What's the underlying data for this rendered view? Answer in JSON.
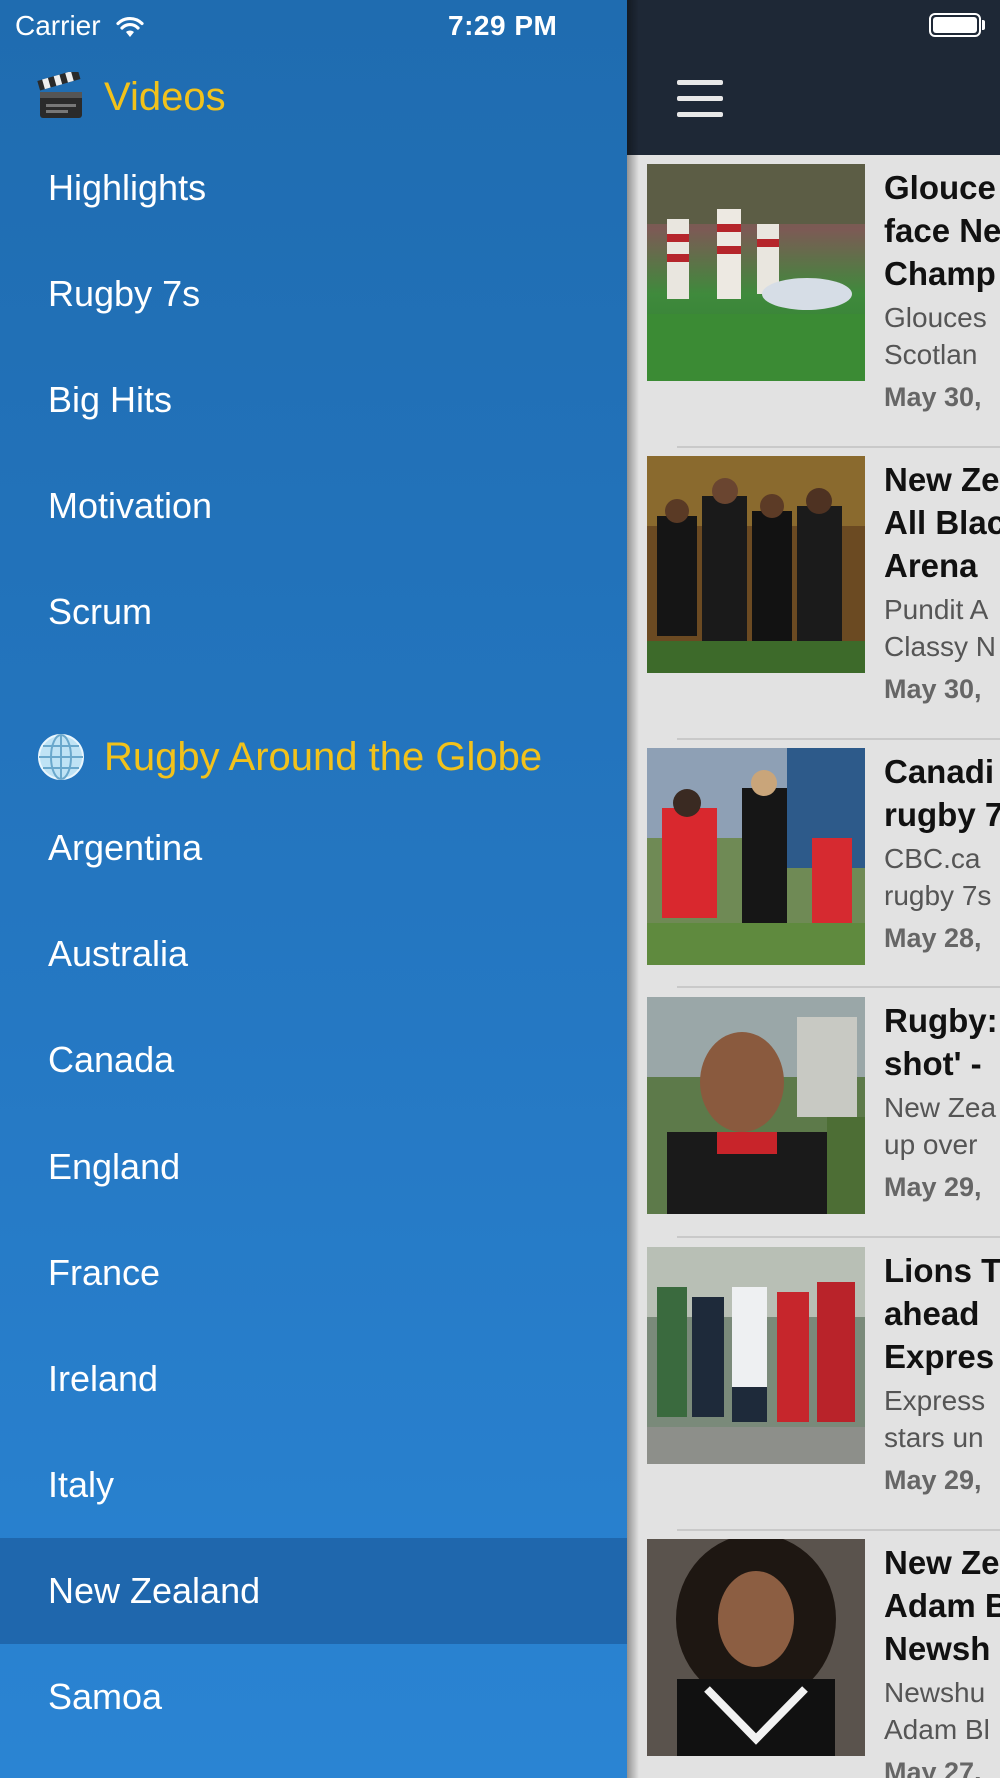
{
  "status_bar": {
    "carrier": "Carrier",
    "time": "7:29 PM"
  },
  "drawer": {
    "sections": [
      {
        "title": "Videos",
        "icon": "clapperboard-icon",
        "items": [
          "Highlights",
          "Rugby 7s",
          "Big Hits",
          "Motivation",
          "Scrum"
        ]
      },
      {
        "title": "Rugby Around the Globe",
        "icon": "globe-icon",
        "items": [
          "Argentina",
          "Australia",
          "Canada",
          "England",
          "France",
          "Ireland",
          "Italy",
          "New Zealand",
          "Samoa"
        ]
      }
    ],
    "selected_item": "New Zealand"
  },
  "colors": {
    "drawer_background": "#2476c0",
    "section_title": "#f2c21b",
    "selected_row": "#1f67ad",
    "navbar": "#1e2836",
    "panel_background": "#e2e2e2"
  },
  "news": {
    "menu_icon": "hamburger-menu-icon",
    "articles": [
      {
        "title_lines": [
          "Glouce",
          "face Ne",
          "Champ"
        ],
        "desc_lines": [
          "Glouces",
          "Scotlan"
        ],
        "date": "May 30,"
      },
      {
        "title_lines": [
          "New Ze",
          "All Blac",
          "Arena"
        ],
        "desc_lines": [
          "Pundit A",
          "Classy N"
        ],
        "date": "May 30,"
      },
      {
        "title_lines": [
          "Canadi",
          "rugby 7"
        ],
        "desc_lines": [
          "CBC.ca",
          "rugby 7s"
        ],
        "date": "May 28,"
      },
      {
        "title_lines": [
          "Rugby:",
          "shot' -"
        ],
        "desc_lines": [
          "New Zea",
          "up over"
        ],
        "date": "May 29,"
      },
      {
        "title_lines": [
          "Lions T",
          "ahead",
          "Expres"
        ],
        "desc_lines": [
          "Express",
          "stars un"
        ],
        "date": "May 29,"
      },
      {
        "title_lines": [
          "New Ze",
          "Adam B",
          "Newsh"
        ],
        "desc_lines": [
          "Newshu",
          "Adam Bl"
        ],
        "date": "May 27,"
      }
    ]
  }
}
